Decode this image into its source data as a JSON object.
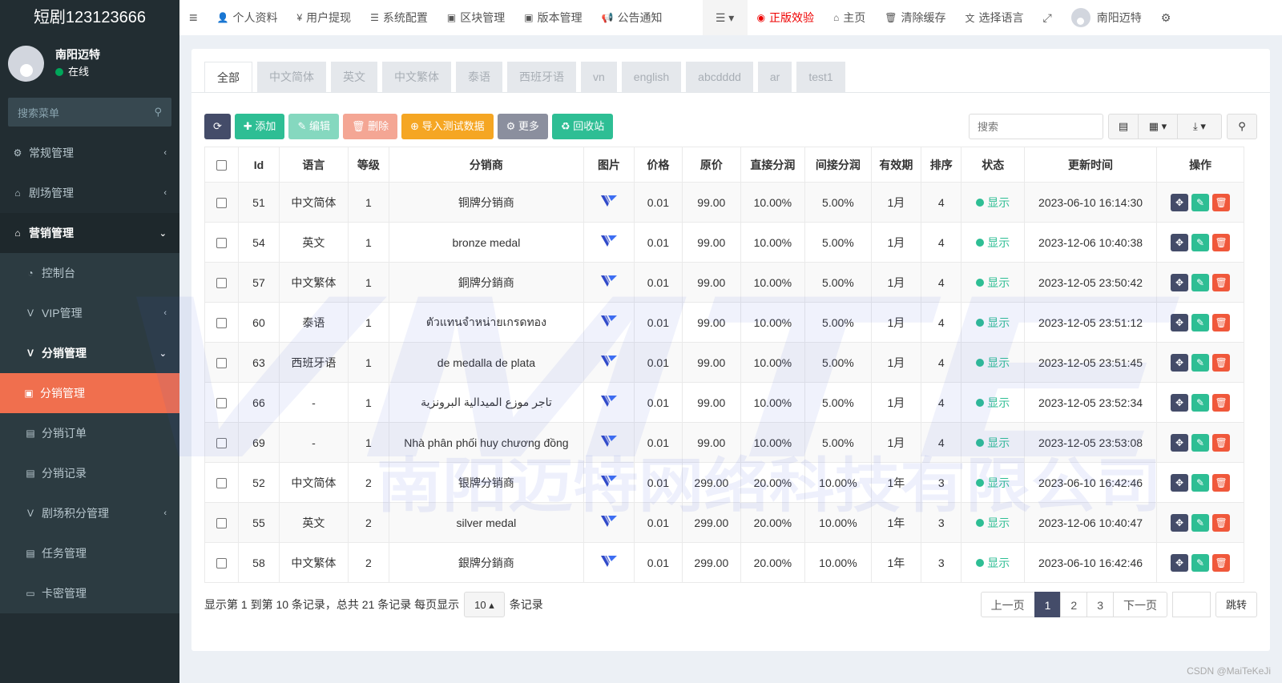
{
  "brand": "短剧123123666",
  "user": {
    "name": "南阳迈特",
    "status": "在线"
  },
  "sidebar": {
    "search_placeholder": "搜索菜单",
    "items": [
      {
        "label": "常规管理",
        "icon": "gears-icon",
        "type": "normal",
        "arrow": "‹"
      },
      {
        "label": "剧场管理",
        "icon": "home-icon",
        "type": "normal",
        "arrow": "‹"
      },
      {
        "label": "营销管理",
        "icon": "home-icon",
        "type": "open",
        "arrow": "⌄"
      },
      {
        "label": "控制台",
        "icon": "dashboard-icon",
        "type": "sub",
        "arrow": ""
      },
      {
        "label": "VIP管理",
        "icon": "v-icon",
        "type": "sub",
        "arrow": "‹"
      },
      {
        "label": "分销管理",
        "icon": "v-icon",
        "type": "openwhite",
        "arrow": "⌄"
      },
      {
        "label": "分销管理",
        "icon": "v-square-icon",
        "type": "active-sub",
        "arrow": ""
      },
      {
        "label": "分销订单",
        "icon": "file-icon",
        "type": "subsub",
        "arrow": ""
      },
      {
        "label": "分销记录",
        "icon": "file-icon",
        "type": "subsub",
        "arrow": ""
      },
      {
        "label": "剧场积分管理",
        "icon": "v-icon",
        "type": "sub",
        "arrow": "‹"
      },
      {
        "label": "任务管理",
        "icon": "file-icon",
        "type": "sub",
        "arrow": ""
      },
      {
        "label": "卡密管理",
        "icon": "card-icon",
        "type": "sub",
        "arrow": ""
      }
    ]
  },
  "topnav": {
    "items": [
      "个人资料",
      "用户提现",
      "系统配置",
      "区块管理",
      "版本管理",
      "公告通知"
    ],
    "right": [
      "正版效验",
      "主页",
      "清除缓存",
      "选择语言"
    ],
    "user": "南阳迈特"
  },
  "tabs": [
    "全部",
    "中文简体",
    "英文",
    "中文繁体",
    "泰语",
    "西班牙语",
    "vn",
    "english",
    "abcdddd",
    "ar",
    "test1"
  ],
  "toolbar": {
    "add": "添加",
    "edit": "编辑",
    "delete": "删除",
    "import": "导入测试数据",
    "more": "更多",
    "recycle": "回收站"
  },
  "search_placeholder": "搜索",
  "columns": [
    "Id",
    "语言",
    "等级",
    "分销商",
    "图片",
    "价格",
    "原价",
    "直接分润",
    "间接分润",
    "有效期",
    "排序",
    "状态",
    "更新时间",
    "操作"
  ],
  "rows": [
    [
      "51",
      "中文简体",
      "1",
      "铜牌分销商",
      "0.01",
      "99.00",
      "10.00%",
      "5.00%",
      "1月",
      "4",
      "显示",
      "2023-06-10 16:14:30"
    ],
    [
      "54",
      "英文",
      "1",
      "bronze medal",
      "0.01",
      "99.00",
      "10.00%",
      "5.00%",
      "1月",
      "4",
      "显示",
      "2023-12-06 10:40:38"
    ],
    [
      "57",
      "中文繁体",
      "1",
      "銅牌分銷商",
      "0.01",
      "99.00",
      "10.00%",
      "5.00%",
      "1月",
      "4",
      "显示",
      "2023-12-05 23:50:42"
    ],
    [
      "60",
      "泰语",
      "1",
      "ตัวแทนจำหน่ายเกรดทอง",
      "0.01",
      "99.00",
      "10.00%",
      "5.00%",
      "1月",
      "4",
      "显示",
      "2023-12-05 23:51:12"
    ],
    [
      "63",
      "西班牙语",
      "1",
      "de medalla de plata",
      "0.01",
      "99.00",
      "10.00%",
      "5.00%",
      "1月",
      "4",
      "显示",
      "2023-12-05 23:51:45"
    ],
    [
      "66",
      "-",
      "1",
      "تاجر موزع الميدالية البرونزية",
      "0.01",
      "99.00",
      "10.00%",
      "5.00%",
      "1月",
      "4",
      "显示",
      "2023-12-05 23:52:34"
    ],
    [
      "69",
      "-",
      "1",
      "Nhà phân phối huy chương đồng",
      "0.01",
      "99.00",
      "10.00%",
      "5.00%",
      "1月",
      "4",
      "显示",
      "2023-12-05 23:53:08"
    ],
    [
      "52",
      "中文简体",
      "2",
      "银牌分销商",
      "0.01",
      "299.00",
      "20.00%",
      "10.00%",
      "1年",
      "3",
      "显示",
      "2023-06-10 16:42:46"
    ],
    [
      "55",
      "英文",
      "2",
      "silver medal",
      "0.01",
      "299.00",
      "20.00%",
      "10.00%",
      "1年",
      "3",
      "显示",
      "2023-12-06 10:40:47"
    ],
    [
      "58",
      "中文繁体",
      "2",
      "銀牌分銷商",
      "0.01",
      "299.00",
      "20.00%",
      "10.00%",
      "1年",
      "3",
      "显示",
      "2023-06-10 16:42:46"
    ]
  ],
  "footer": {
    "summary": "显示第 1 到第 10 条记录，总共 21 条记录 每页显示",
    "page_size": "10",
    "suffix": "条记录"
  },
  "pager": {
    "prev": "上一页",
    "pages": [
      "1",
      "2",
      "3"
    ],
    "next": "下一页",
    "jump": "跳转"
  },
  "watermark": {
    "logo": "VMTE",
    "company": "南阳迈特网络科技有限公司"
  },
  "credit": "CSDN @MaiTeKeJi"
}
